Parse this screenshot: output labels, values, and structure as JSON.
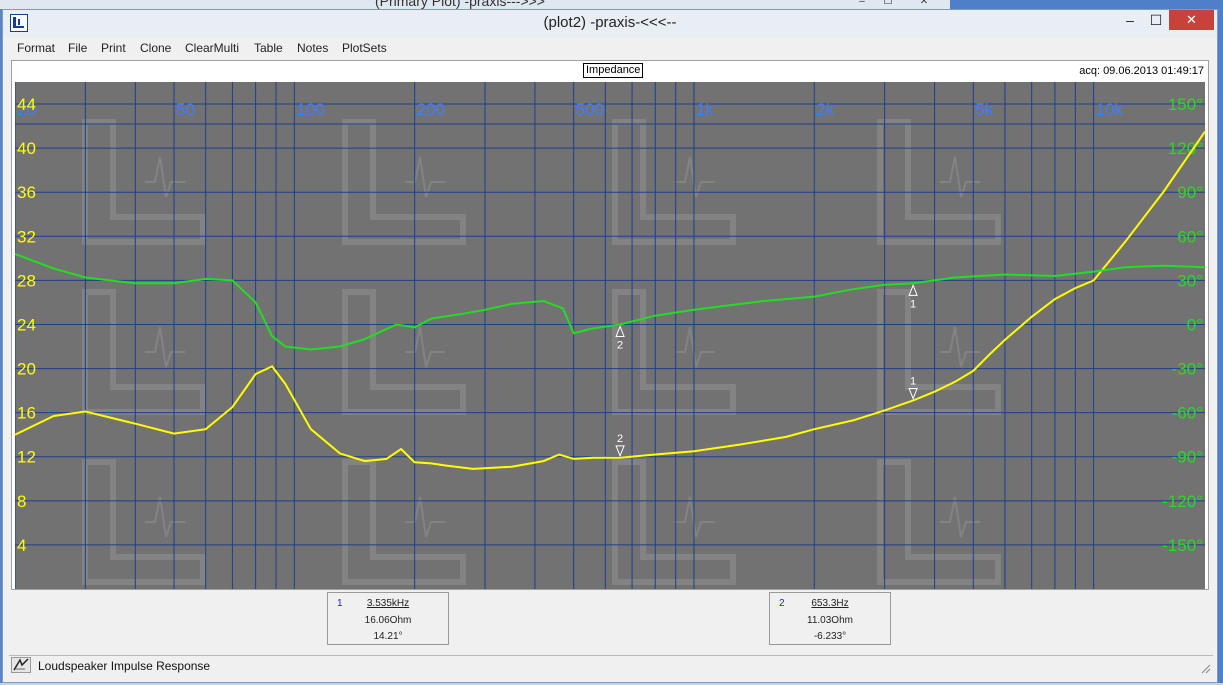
{
  "background_window": {
    "title": "(Primary Plot) -praxis--->>>"
  },
  "window": {
    "title": "(plot2) -praxis-<<<--",
    "app_icon": "praxis-logo-icon",
    "minimize_glyph": "–",
    "maximize_glyph": "☐",
    "close_glyph": "✕"
  },
  "menu": [
    "Format",
    "File",
    "Print",
    "Clone",
    "ClearMulti",
    "Table",
    "Notes",
    "PlotSets"
  ],
  "plot": {
    "title": "Impedance",
    "acq": "acq: 09.06.2013 01:49:17"
  },
  "chart_data": {
    "type": "line",
    "title": "Impedance",
    "x_scale": "log",
    "xlim": [
      20,
      19000
    ],
    "x_tick_labels": [
      {
        "value": 20,
        "label": "20"
      },
      {
        "value": 50,
        "label": "50"
      },
      {
        "value": 100,
        "label": "100"
      },
      {
        "value": 200,
        "label": "200"
      },
      {
        "value": 500,
        "label": "500"
      },
      {
        "value": 1000,
        "label": "1k"
      },
      {
        "value": 2000,
        "label": "2k"
      },
      {
        "value": 5000,
        "label": "5k"
      },
      {
        "value": 10000,
        "label": "10k"
      }
    ],
    "y_left": {
      "lim": [
        0,
        46
      ],
      "ticks": [
        4,
        8,
        12,
        16,
        20,
        24,
        28,
        32,
        36,
        40,
        44
      ],
      "color": "#ffff00"
    },
    "y_right": {
      "lim": [
        -180,
        165
      ],
      "ticks": [
        150,
        120,
        90,
        60,
        30,
        0,
        -30,
        -60,
        -90,
        -120,
        -150
      ],
      "suffix": "°",
      "color": "#22dd22"
    },
    "grid": true,
    "series": [
      {
        "axis": "left",
        "color": "#ffff00",
        "points": [
          [
            20,
            14.0
          ],
          [
            25,
            15.7
          ],
          [
            30,
            16.1
          ],
          [
            40,
            15.0
          ],
          [
            50,
            14.1
          ],
          [
            60,
            14.5
          ],
          [
            70,
            16.5
          ],
          [
            80,
            19.5
          ],
          [
            88,
            20.2
          ],
          [
            95,
            18.6
          ],
          [
            110,
            14.5
          ],
          [
            130,
            12.3
          ],
          [
            150,
            11.6
          ],
          [
            170,
            11.8
          ],
          [
            185,
            12.7
          ],
          [
            200,
            11.5
          ],
          [
            220,
            11.4
          ],
          [
            240,
            11.2
          ],
          [
            280,
            10.9
          ],
          [
            350,
            11.1
          ],
          [
            420,
            11.6
          ],
          [
            460,
            12.2
          ],
          [
            500,
            11.8
          ],
          [
            560,
            11.9
          ],
          [
            653,
            11.9
          ],
          [
            800,
            12.2
          ],
          [
            1000,
            12.5
          ],
          [
            1300,
            13.1
          ],
          [
            1700,
            13.8
          ],
          [
            2000,
            14.5
          ],
          [
            2500,
            15.3
          ],
          [
            3000,
            16.2
          ],
          [
            3535,
            17.1
          ],
          [
            4000,
            17.9
          ],
          [
            4500,
            18.8
          ],
          [
            5000,
            19.8
          ],
          [
            5500,
            21.3
          ],
          [
            6000,
            22.6
          ],
          [
            7000,
            24.7
          ],
          [
            8000,
            26.3
          ],
          [
            9000,
            27.3
          ],
          [
            10000,
            28.0
          ],
          [
            12000,
            31.5
          ],
          [
            15000,
            36.1
          ],
          [
            19000,
            41.5
          ]
        ]
      },
      {
        "axis": "right",
        "color": "#22dd22",
        "points": [
          [
            20,
            48
          ],
          [
            25,
            38
          ],
          [
            30,
            32
          ],
          [
            40,
            28
          ],
          [
            50,
            28
          ],
          [
            60,
            31
          ],
          [
            70,
            30
          ],
          [
            80,
            15
          ],
          [
            88,
            -8
          ],
          [
            95,
            -15
          ],
          [
            110,
            -17
          ],
          [
            130,
            -15
          ],
          [
            150,
            -10
          ],
          [
            180,
            0
          ],
          [
            200,
            -2
          ],
          [
            220,
            4
          ],
          [
            260,
            7
          ],
          [
            300,
            10
          ],
          [
            350,
            14
          ],
          [
            420,
            16
          ],
          [
            470,
            11
          ],
          [
            500,
            -6
          ],
          [
            550,
            -3
          ],
          [
            653,
            0
          ],
          [
            800,
            6
          ],
          [
            1000,
            10
          ],
          [
            1500,
            16
          ],
          [
            2000,
            19
          ],
          [
            2500,
            24
          ],
          [
            3000,
            27
          ],
          [
            3535,
            28
          ],
          [
            4500,
            32
          ],
          [
            6000,
            34
          ],
          [
            8000,
            33
          ],
          [
            10000,
            36
          ],
          [
            12000,
            39
          ],
          [
            15000,
            40
          ],
          [
            19000,
            39
          ]
        ]
      }
    ],
    "markers": [
      {
        "label": "1",
        "x": 3535
      },
      {
        "label": "2",
        "x": 653.3
      }
    ]
  },
  "cursors": [
    {
      "num": "1",
      "freq": "3.535kHz",
      "ohm": "16.06Ohm",
      "deg": "14.21°"
    },
    {
      "num": "2",
      "freq": "653.3Hz",
      "ohm": "11.03Ohm",
      "deg": "-6.233°"
    }
  ],
  "status": {
    "text": "Loudspeaker Impulse Response",
    "icon": "impulse-tool-icon"
  },
  "grip_icon": "resize-grip-icon"
}
